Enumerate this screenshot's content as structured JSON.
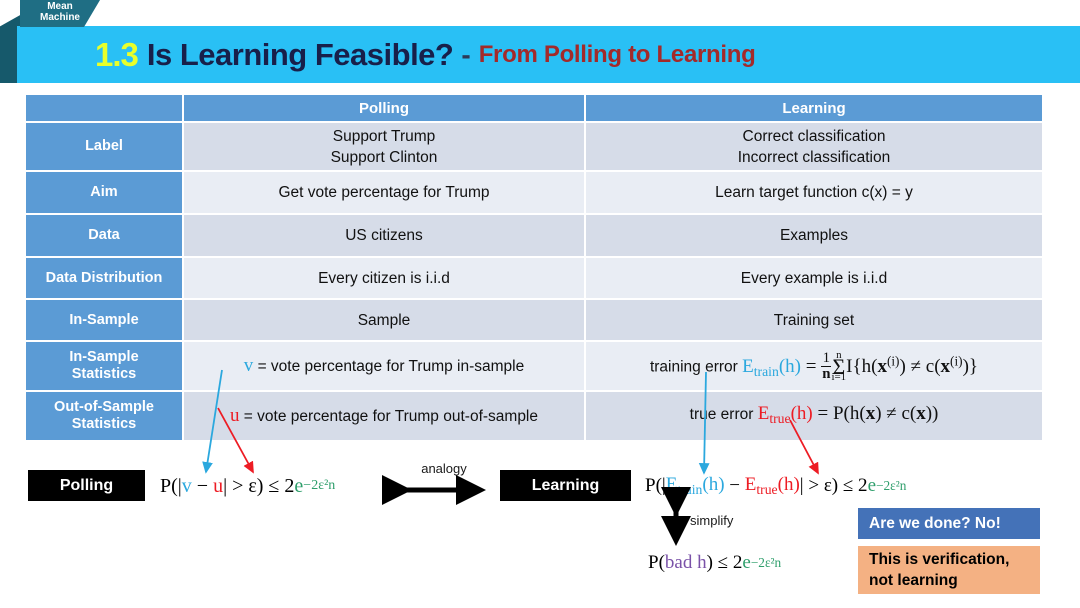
{
  "logo": {
    "text": "Mean\nMachine"
  },
  "header": {
    "number": "1.3",
    "title": "Is Learning Feasible?",
    "dash": "-",
    "subtitle": "From Polling to Learning",
    "bar_color": "#29C0F5",
    "number_color": "#E8FF2A",
    "title_color": "#18204A",
    "subtitle_color": "#A32A2A"
  },
  "table": {
    "header_color": "#5B9BD5",
    "row_shade_a": "#D6DCE8",
    "row_shade_b": "#E9EDF4",
    "columns": [
      "",
      "Polling",
      "Learning"
    ],
    "rows": [
      {
        "label": "Label",
        "polling": "Support Trump\nSupport Clinton",
        "learning": "Correct classification\nIncorrect classification"
      },
      {
        "label": "Aim",
        "polling": "Get vote percentage for Trump",
        "learning": "Learn target function c(x) = y"
      },
      {
        "label": "Data",
        "polling": "US citizens",
        "learning": "Examples"
      },
      {
        "label": "Data Distribution",
        "polling": "Every citizen is  i.i.d",
        "learning": "Every example is i.i.d"
      },
      {
        "label": "In-Sample",
        "polling": "Sample",
        "learning": "Training set"
      },
      {
        "label": "In-Sample\nStatistics",
        "polling_math": {
          "symbol": "v",
          "symbol_color": "#2BA8DE",
          "text": "= vote percentage for Trump in-sample"
        },
        "learning_math": {
          "prefix": "training error",
          "symbol": "E",
          "symbol_sub": "train",
          "symbol_color": "#2BA8DE",
          "formula": "(h) = 1/n Σ i=1..n I{h(x⁽ⁱ⁾) ≠ c(x⁽ⁱ⁾)}"
        }
      },
      {
        "label": "Out-of-Sample\nStatistics",
        "polling_math": {
          "symbol": "u",
          "symbol_color": "#ED1C24",
          "text": "= vote percentage for Trump out-of-sample"
        },
        "learning_math": {
          "prefix": "true error",
          "symbol": "E",
          "symbol_sub": "true",
          "symbol_color": "#ED1C24",
          "formula": "(h) = P(h(x) ≠ c(x))"
        }
      }
    ]
  },
  "bottom": {
    "polling_tag": "Polling",
    "learning_tag": "Learning",
    "analogy_label": "analogy",
    "simplify_label": "simplify",
    "polling_formula": "P(|v − u| > ε) ≤ 2e^(−2ε²n)",
    "learning_formula": "P(|E_train(h) − E_true(h)| > ε) ≤ 2e^(−2ε²n)",
    "simplified_formula": "P(bad h) ≤ 2e^(−2ε²n)",
    "callout_blue": "Are we done? No!",
    "callout_orange": "This is verification,\nnot learning",
    "callout_blue_color": "#4472B8",
    "callout_orange_color": "#F4B183"
  },
  "math_tokens": {
    "P": "P",
    "open_abs": "(|",
    "v": "v",
    "minus": "−",
    "u": "u",
    "close_abs_gt": "| > ε) ≤ 2",
    "e": "e",
    "exp": "−2ε²n",
    "E": "E",
    "train": "train",
    "true": "true",
    "paren_h": "(h)",
    "bad_h": "bad h",
    "eq": " = ",
    "one": "1",
    "n": "n",
    "sigma": "Σ",
    "sum_top": "n",
    "sum_bot": "i=1",
    "indicator": "I{h(",
    "x": "x",
    "sup_i": "(i)",
    "neq": ") ≠ c(",
    "close_ind": ")}",
    "prob_h": "P(h(",
    "neq2": ") ≠ c(",
    "close2": "))",
    "training_error": "training error",
    "true_error": "true error",
    "v_text": "= vote percentage for Trump in-sample",
    "u_text": "= vote percentage for Trump out-of-sample"
  }
}
